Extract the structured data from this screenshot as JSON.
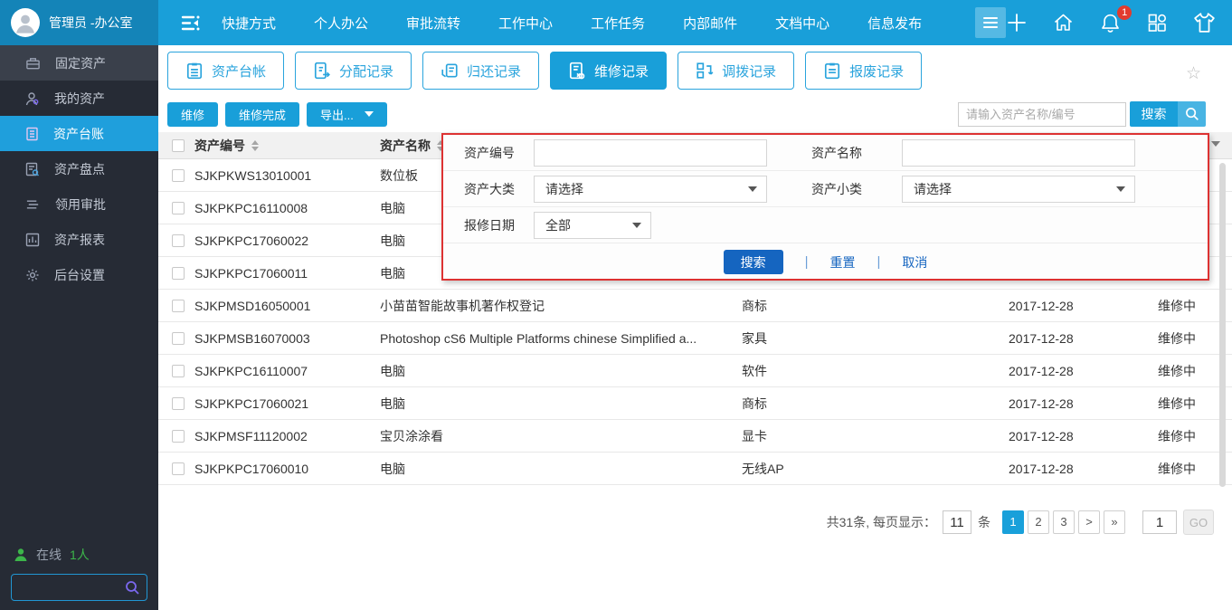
{
  "colors": {
    "topbar": "#199fd9",
    "topbar_left": "#1484b8",
    "sidebar": "#262b35",
    "active_item": "#1f9fdc",
    "panel_border": "#dd3232",
    "deep_blue": "#1565c0",
    "badge_red": "#e23b2e",
    "online_green": "#3cb54a"
  },
  "topbar": {
    "user": "管理员 -办公室",
    "nav": [
      "快捷方式",
      "个人办公",
      "审批流转",
      "工作中心",
      "工作任务",
      "内部邮件",
      "文档中心",
      "信息发布"
    ],
    "bell_badge": "1"
  },
  "sidebar": {
    "items": [
      {
        "label": "固定资产"
      },
      {
        "label": "我的资产"
      },
      {
        "label": "资产台账"
      },
      {
        "label": "资产盘点"
      },
      {
        "label": "领用审批"
      },
      {
        "label": "资产报表"
      },
      {
        "label": "后台设置"
      }
    ],
    "online_label": "在线",
    "online_count": "1人"
  },
  "tabs": [
    {
      "label": "资产台帐"
    },
    {
      "label": "分配记录"
    },
    {
      "label": "归还记录"
    },
    {
      "label": "维修记录"
    },
    {
      "label": "调拨记录"
    },
    {
      "label": "报废记录"
    }
  ],
  "toolbar": {
    "repair": "维修",
    "repair_done": "维修完成",
    "export": "导出...",
    "search_placeholder": "请输入资产名称/编号",
    "search": "搜索"
  },
  "filter_panel": {
    "code_label": "资产编号",
    "name_label": "资产名称",
    "major_label": "资产大类",
    "minor_label": "资产小类",
    "date_label": "报修日期",
    "select_placeholder": "请选择",
    "date_value": "全部",
    "search": "搜索",
    "reset": "重置",
    "cancel": "取消",
    "sep": "|"
  },
  "table": {
    "headers": {
      "code": "资产编号",
      "name": "资产名称"
    },
    "rows": [
      {
        "code": "SJKPKWS13010001",
        "name": "数位板",
        "cat": "",
        "date": "",
        "status": ""
      },
      {
        "code": "SJKPKPC16110008",
        "name": "电脑",
        "cat": "",
        "date": "",
        "status": ""
      },
      {
        "code": "SJKPKPC17060022",
        "name": "电脑",
        "cat": "",
        "date": "",
        "status": ""
      },
      {
        "code": "SJKPKPC17060011",
        "name": "电脑",
        "cat": "",
        "date": "",
        "status": ""
      },
      {
        "code": "SJKPMSD16050001",
        "name": "小苗苗智能故事机著作权登记",
        "cat": "商标",
        "date": "2017-12-28",
        "status": "维修中"
      },
      {
        "code": "SJKPMSB16070003",
        "name": "Photoshop cS6 Multiple Platforms chinese Simplified a...",
        "cat": "家具",
        "date": "2017-12-28",
        "status": "维修中"
      },
      {
        "code": "SJKPKPC16110007",
        "name": "电脑",
        "cat": "软件",
        "date": "2017-12-28",
        "status": "维修中"
      },
      {
        "code": "SJKPKPC17060021",
        "name": "电脑",
        "cat": "商标",
        "date": "2017-12-28",
        "status": "维修中"
      },
      {
        "code": "SJKPMSF11120002",
        "name": "宝贝涂涂看",
        "cat": "显卡",
        "date": "2017-12-28",
        "status": "维修中"
      },
      {
        "code": "SJKPKPC17060010",
        "name": "电脑",
        "cat": "无线AP",
        "date": "2017-12-28",
        "status": "维修中"
      }
    ]
  },
  "pagination": {
    "summary": "共31条, 每页显示：",
    "page_size": "11",
    "unit": "条",
    "pages": [
      "1",
      "2",
      "3"
    ],
    "next": ">",
    "last": "»",
    "goto_value": "1",
    "go": "GO"
  }
}
